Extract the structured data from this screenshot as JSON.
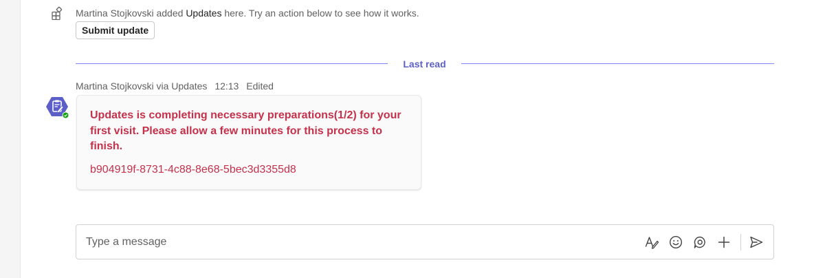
{
  "system_message": {
    "user": "Martina Stojkovski",
    "added_text": "added",
    "app_name": "Updates",
    "rest": "here. Try an action below to see how it works.",
    "button_label": "Submit update"
  },
  "divider": {
    "label": "Last read"
  },
  "message": {
    "sender": "Martina Stojkovski via Updates",
    "time": "12:13",
    "status": "Edited",
    "card": {
      "title": "Updates is completing necessary preparations(1/2) for your first visit. Please allow a few minutes for this process to finish.",
      "id": "b904919f-8731-4c88-8e68-5bec3d3355d8"
    }
  },
  "composer": {
    "placeholder": "Type a message",
    "icons": [
      "format-icon",
      "emoji-icon",
      "loop-icon",
      "plus-icon",
      "send-icon"
    ]
  },
  "colors": {
    "accent": "#5b5fc7",
    "divider_line": "#7f85f5",
    "error_text": "#c4314b",
    "presence_green": "#13a10e"
  }
}
